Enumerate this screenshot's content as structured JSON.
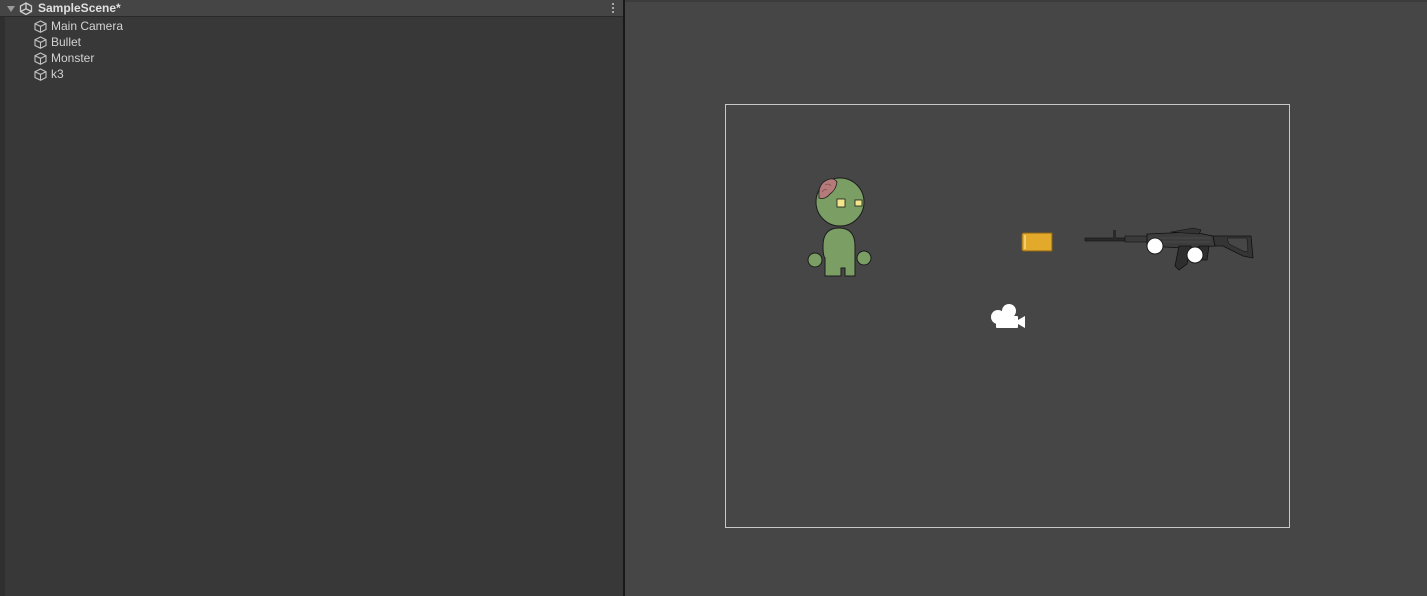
{
  "hierarchy": {
    "scene_name": "SampleScene*",
    "items": [
      {
        "label": "Main Camera",
        "icon": "cube-icon"
      },
      {
        "label": "Bullet",
        "icon": "cube-icon"
      },
      {
        "label": "Monster",
        "icon": "cube-icon"
      },
      {
        "label": "k3",
        "icon": "cube-icon"
      }
    ]
  },
  "viewport": {
    "sprites": [
      "monster-sprite",
      "bullet-sprite",
      "rifle-sprite",
      "camera-gizmo-icon"
    ]
  },
  "colors": {
    "panel_bg": "#383838",
    "scene_header_bg": "#454545",
    "viewport_bg": "#464646",
    "monster_green": "#7a9e64",
    "bullet_gold": "#e2a92b"
  }
}
